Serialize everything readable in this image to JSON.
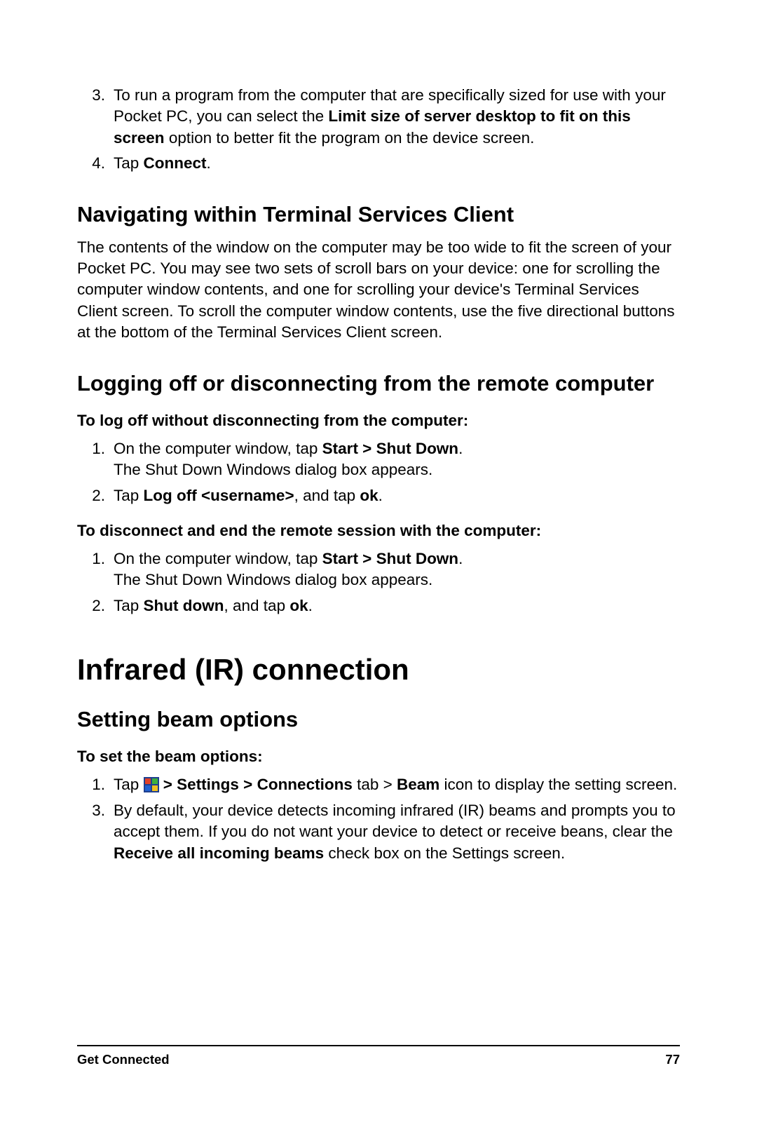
{
  "top_list": {
    "item3": {
      "marker": "3.",
      "pre": "To run a program from the computer that are specifically sized for use with your Pocket PC, you can select the ",
      "bold": "Limit size of server desktop to fit on this screen",
      "post": " option to better fit the program on the device screen."
    },
    "item4": {
      "marker": "4.",
      "pre": "Tap ",
      "bold": "Connect",
      "post": "."
    }
  },
  "sec_navigating": {
    "heading": "Navigating within Terminal Services Client",
    "body": "The contents of the window on the computer may be too wide to fit the screen of your Pocket PC. You may see two sets of scroll bars on your device: one for scrolling the computer window contents, and one for scrolling your device's Terminal Services Client screen. To scroll the computer window contents, use the five directional buttons at the bottom of the Terminal Services Client screen."
  },
  "sec_logging": {
    "heading": "Logging off or disconnecting from the remote computer",
    "sub1": "To log off without disconnecting from the computer:",
    "list1": {
      "item1": {
        "marker": "1.",
        "pre": "On the computer window, tap ",
        "bold": "Start > Shut Down",
        "post": ".",
        "line2": "The Shut Down Windows dialog box appears."
      },
      "item2": {
        "marker": "2.",
        "pre": "Tap ",
        "bold1": "Log off <username>",
        "mid": ", and tap ",
        "bold2": "ok",
        "post": "."
      }
    },
    "sub2": "To disconnect and end the remote session with the computer:",
    "list2": {
      "item1": {
        "marker": "1.",
        "pre": "On the computer window, tap ",
        "bold": "Start > Shut Down",
        "post": ".",
        "line2": "The Shut Down Windows dialog box appears."
      },
      "item2": {
        "marker": "2.",
        "pre": "Tap ",
        "bold1": "Shut down",
        "mid": ", and tap ",
        "bold2": "ok",
        "post": "."
      }
    }
  },
  "sec_infrared": {
    "heading": "Infrared (IR) connection",
    "sub_heading": "Setting beam options",
    "sub1": "To set the beam options:",
    "list": {
      "item1": {
        "marker": "1.",
        "pre": "Tap ",
        "bold": " > Settings > Connections",
        "mid": " tab > ",
        "bold2": "Beam",
        "post": " icon to display the setting screen."
      },
      "item3": {
        "marker": "3.",
        "pre": "By default, your device detects incoming infrared (IR) beams and prompts you to accept them. If you do not want your device to detect or receive beans, clear the ",
        "bold": "Receive all incoming beams",
        "post": " check box on the Settings screen."
      }
    }
  },
  "footer": {
    "left": "Get Connected",
    "right": "77"
  }
}
